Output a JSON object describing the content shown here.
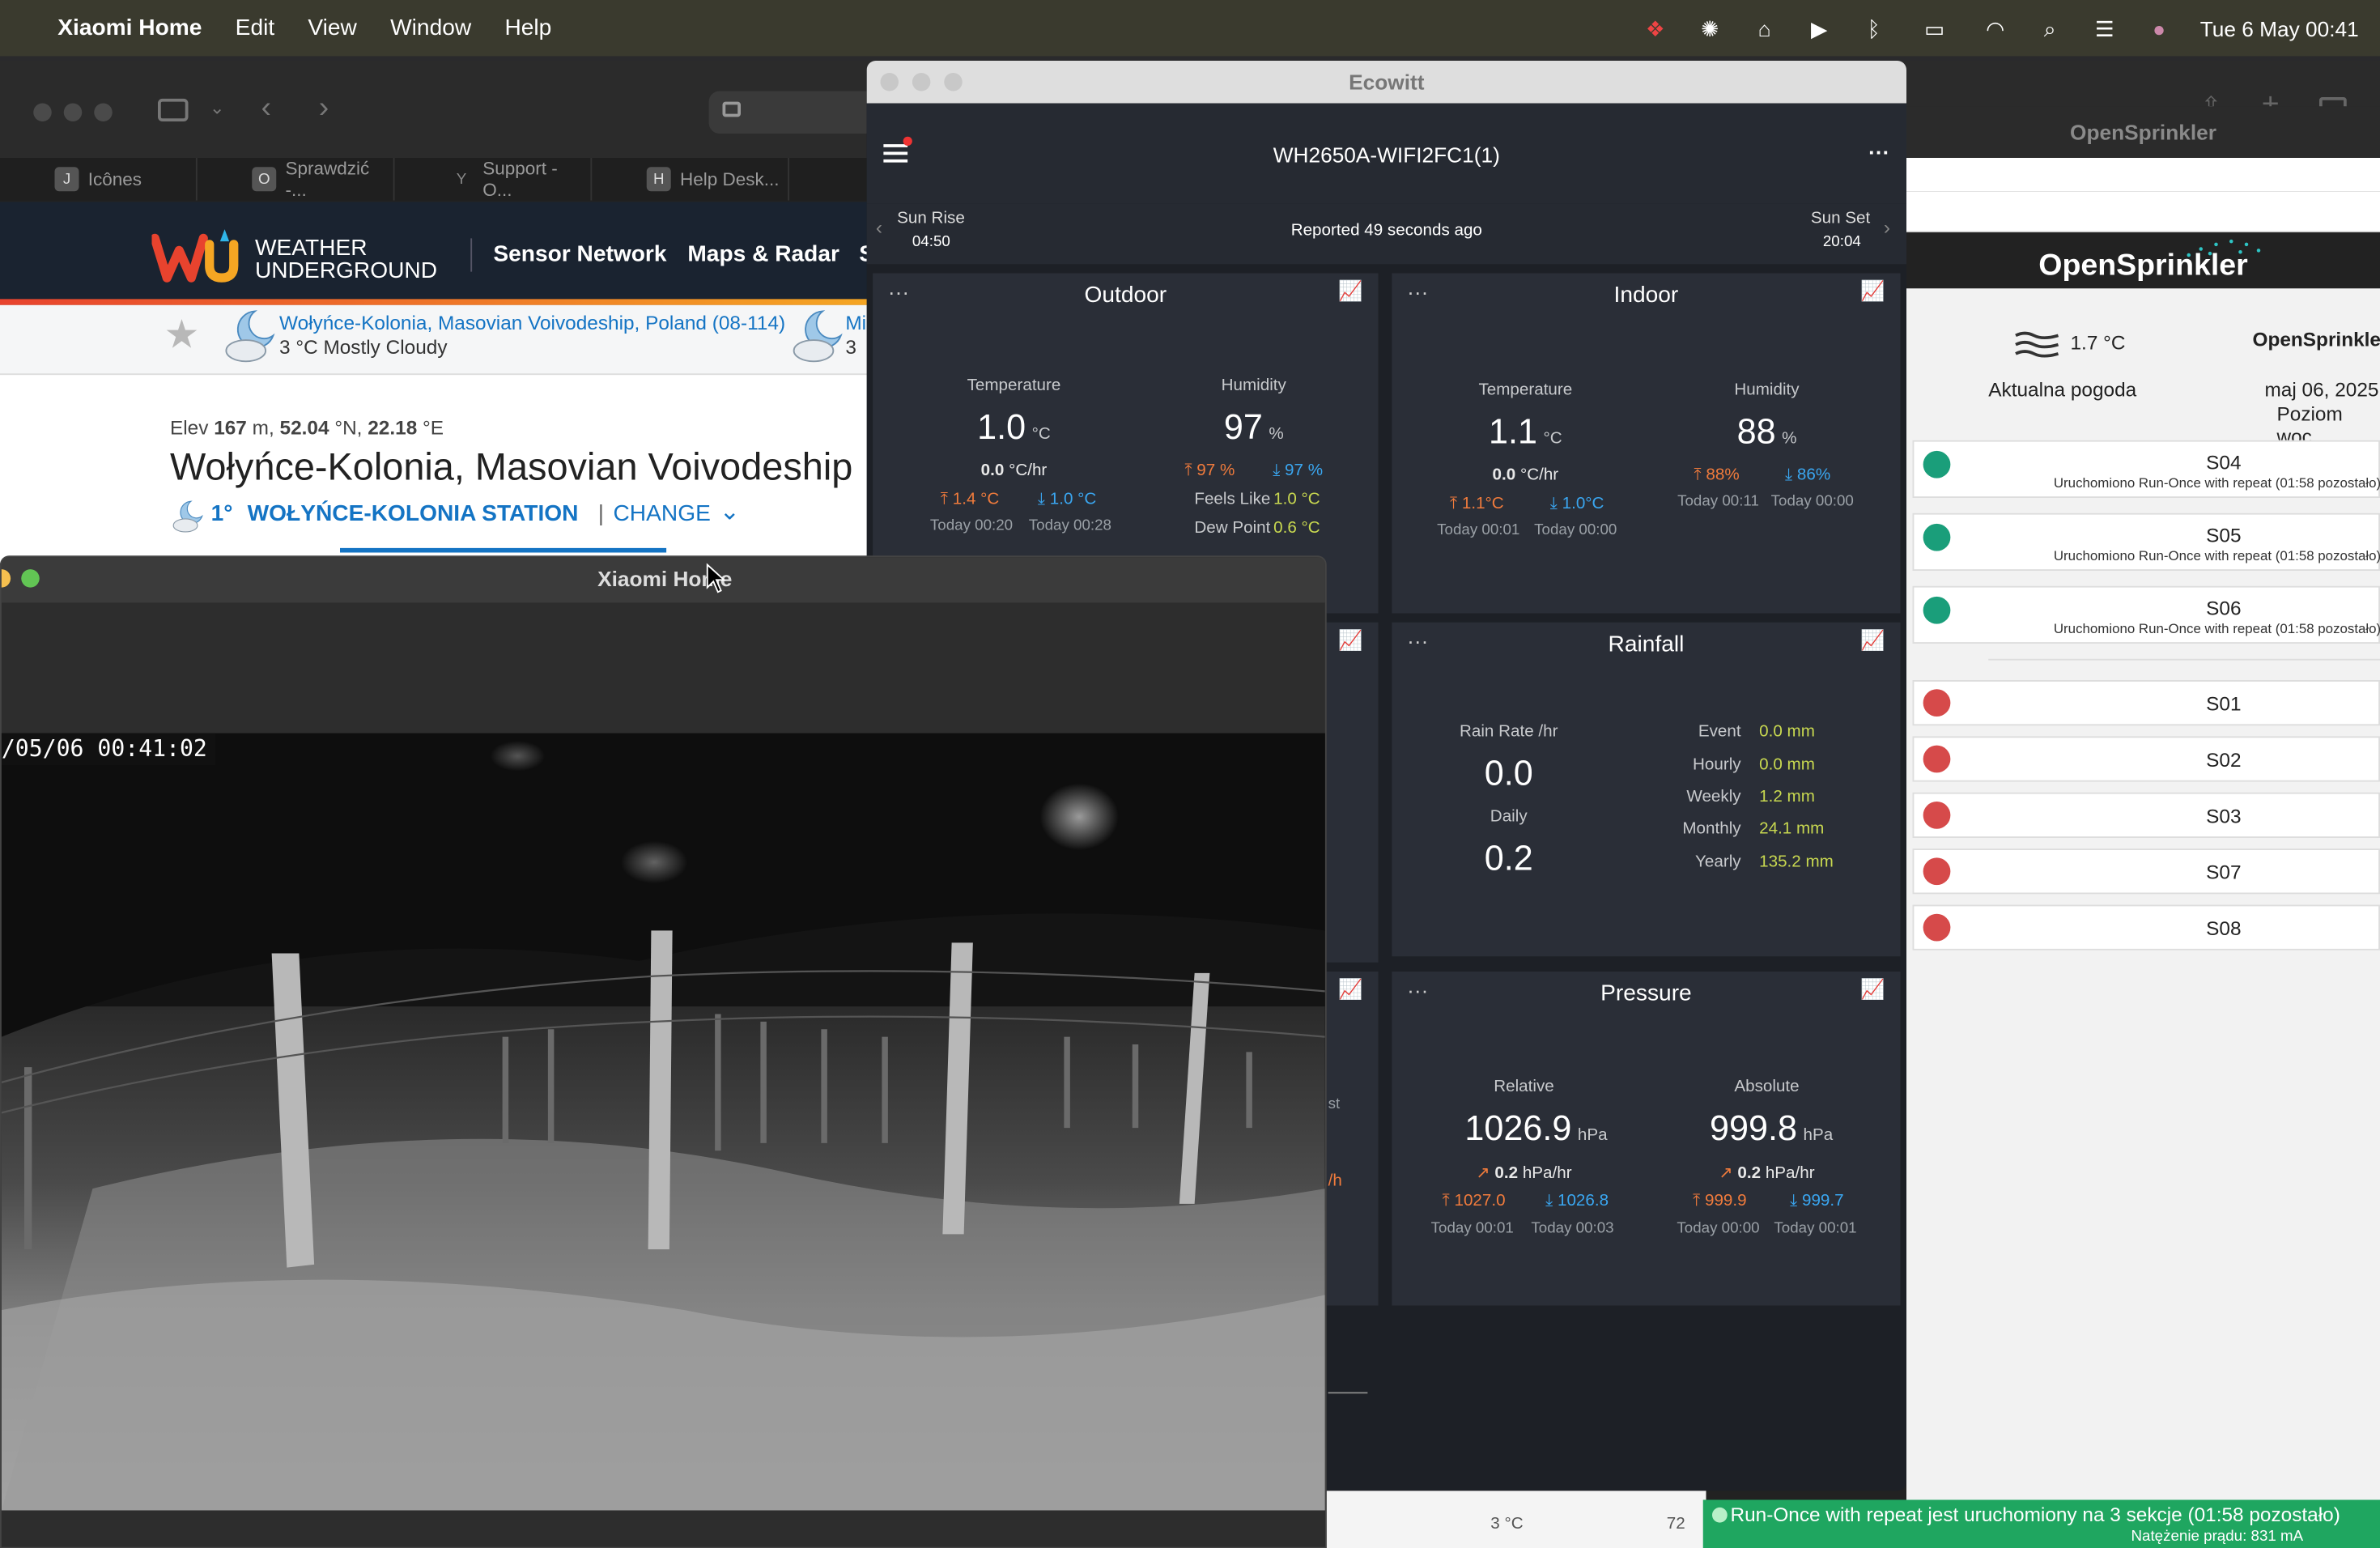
{
  "menubar": {
    "app": "Xiaomi Home",
    "items": [
      "Edit",
      "View",
      "Window",
      "Help"
    ],
    "datetime": "Tue 6 May  00:41"
  },
  "browser": {
    "tabs": [
      {
        "icon": "J",
        "label": "Icônes"
      },
      {
        "icon": "O",
        "label": "Sprawdzić -..."
      },
      {
        "icon": "Y",
        "label": "Support - O..."
      },
      {
        "icon": "H",
        "label": "Help Desk..."
      }
    ]
  },
  "wu": {
    "logo_line1": "WEATHER",
    "logo_line2": "UNDERGROUND",
    "nav": [
      "Sensor Network",
      "Maps & Radar",
      "S"
    ],
    "location_link": "Wołyńce-Kolonia, Masovian Voivodeship, Poland (08-114)",
    "location_cond": "3 °C Mostly Cloudy",
    "second_link": "Mi",
    "second_cond": "3",
    "elev_prefix": "Elev ",
    "elev_value": "167",
    "elev_mid": " m, ",
    "lat": "52.04",
    "lat_unit": " °N, ",
    "lon": "22.18",
    "lon_unit": " °E",
    "heading": "Wołyńce-Kolonia, Masovian Voivodeship",
    "temp": "1°",
    "station": "WOŁYŃCE-KOLONIA STATION",
    "sep": "|",
    "change": "CHANGE"
  },
  "ecowitt": {
    "window_title": "Ecowitt",
    "device": "WH2650A-WIFI2FC1(1)",
    "sunrise_label": "Sun Rise",
    "sunrise": "04:50",
    "sunset_label": "Sun Set",
    "sunset": "20:04",
    "reported": "Reported 49 seconds ago",
    "outdoor": {
      "title": "Outdoor",
      "temp_label": "Temperature",
      "temp": "1.0",
      "temp_unit": "°C",
      "temp_rate": "0.0",
      "temp_rate_unit": "°C/hr",
      "temp_hi": "1.4 °C",
      "temp_lo": "1.0 °C",
      "temp_hi_time": "Today 00:20",
      "temp_lo_time": "Today 00:28",
      "hum_label": "Humidity",
      "hum": "97",
      "hum_unit": "%",
      "hum_hi": "97 %",
      "hum_lo": "97 %",
      "feels_label": "Feels Like",
      "feels": "1.0 °C",
      "dew_label": "Dew Point",
      "dew": "0.6 °C"
    },
    "indoor": {
      "title": "Indoor",
      "temp_label": "Temperature",
      "temp": "1.1",
      "temp_unit": "°C",
      "temp_rate": "0.0",
      "temp_rate_unit": "°C/hr",
      "temp_hi": "1.1°C",
      "temp_lo": "1.0°C",
      "temp_hi_time": "Today 00:01",
      "temp_lo_time": "Today 00:00",
      "hum_label": "Humidity",
      "hum": "88",
      "hum_unit": "%",
      "hum_hi": "88%",
      "hum_lo": "86%",
      "hum_hi_time": "Today 00:11",
      "hum_lo_time": "Today 00:00"
    },
    "rainfall": {
      "title": "Rainfall",
      "rate_label": "Rain Rate /hr",
      "rate": "0.0",
      "daily_label": "Daily",
      "daily": "0.2",
      "rows": [
        {
          "label": "Event",
          "value": "0.0 mm"
        },
        {
          "label": "Hourly",
          "value": "0.0 mm"
        },
        {
          "label": "Weekly",
          "value": "1.2 mm"
        },
        {
          "label": "Monthly",
          "value": "24.1 mm"
        },
        {
          "label": "Yearly",
          "value": "135.2 mm"
        }
      ]
    },
    "pressure": {
      "title": "Pressure",
      "rel_label": "Relative",
      "rel": "1026.9",
      "abs_label": "Absolute",
      "abs": "999.8",
      "unit": "hPa",
      "rel_rate": "0.2",
      "abs_rate": "0.2",
      "rate_unit": "hPa/hr",
      "rel_hi": "1027.0",
      "rel_lo": "1026.8",
      "rel_hi_time": "Today 00:01",
      "rel_lo_time": "Today 00:03",
      "abs_hi": "999.9",
      "abs_lo": "999.7",
      "abs_hi_time": "Today 00:00",
      "abs_lo_time": "Today 00:01"
    },
    "partial_left": {
      "a": "st",
      "b": "/h"
    }
  },
  "opensprinkler": {
    "window_title": "OpenSprinkler",
    "brand": "OpenSprinkler",
    "weather_temp": "1.7 °C",
    "weather_label": "Aktualna pogoda",
    "name": "OpenSprinkler",
    "date": "maj 06, 2025",
    "level": "Poziom woc",
    "running": [
      {
        "name": "S04",
        "sub": "Uruchomiono Run-Once with repeat (01:58 pozostało)"
      },
      {
        "name": "S05",
        "sub": "Uruchomiono Run-Once with repeat (01:58 pozostało)"
      },
      {
        "name": "S06",
        "sub": "Uruchomiono Run-Once with repeat (01:58 pozostało)"
      }
    ],
    "idle": [
      "S01",
      "S02",
      "S03",
      "S07",
      "S08"
    ],
    "footer": "Run-Once with repeat jest uruchomiony na 3 sekcje (01:58 pozostało)",
    "current": "Natężenie prądu: 831 mA",
    "bottom_partial_a": "3 °C",
    "bottom_partial_b": "72"
  },
  "xiaomi": {
    "window_title": "Xiaomi Home",
    "timestamp": "/05/06  00:41:02"
  },
  "colors": {
    "running": "#1a9e7a",
    "idle": "#d64a4a",
    "wu_blue": "#1474c4",
    "os_footer": "#1fa660"
  }
}
